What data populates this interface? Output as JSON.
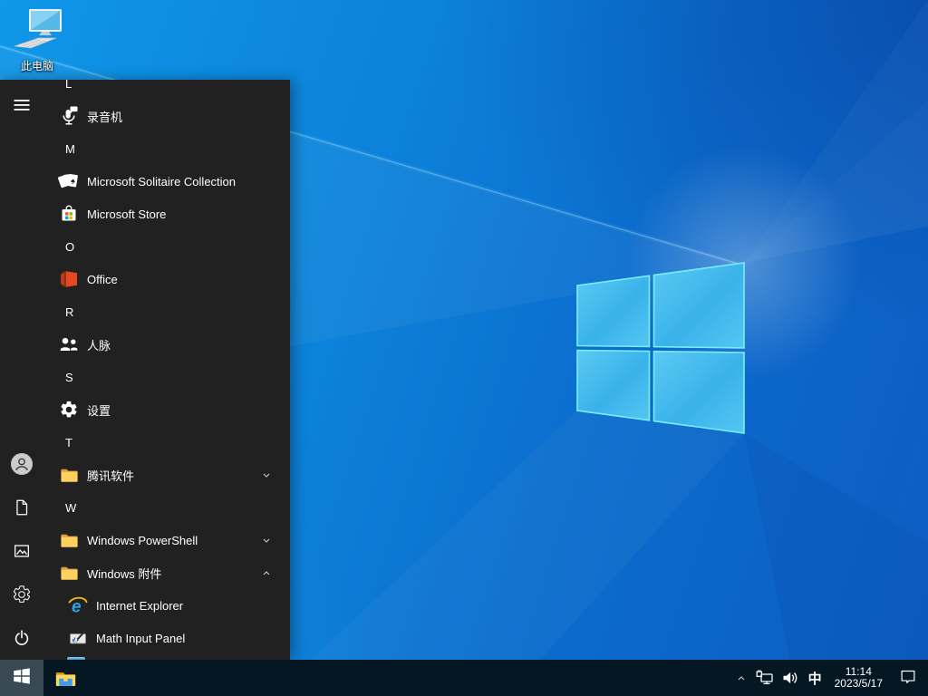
{
  "desktop": {
    "this_pc_label": "此电脑"
  },
  "start_menu": {
    "items": [
      {
        "type": "header",
        "label": "L"
      },
      {
        "type": "app",
        "label": "录音机",
        "icon": "voice-recorder"
      },
      {
        "type": "header",
        "label": "M"
      },
      {
        "type": "app",
        "label": "Microsoft Solitaire Collection",
        "icon": "solitaire"
      },
      {
        "type": "app",
        "label": "Microsoft Store",
        "icon": "store"
      },
      {
        "type": "header",
        "label": "O"
      },
      {
        "type": "app",
        "label": "Office",
        "icon": "office"
      },
      {
        "type": "header",
        "label": "R"
      },
      {
        "type": "app",
        "label": "人脉",
        "icon": "people"
      },
      {
        "type": "header",
        "label": "S"
      },
      {
        "type": "app",
        "label": "设置",
        "icon": "gear"
      },
      {
        "type": "header",
        "label": "T"
      },
      {
        "type": "folder",
        "label": "腾讯软件",
        "icon": "folder",
        "chevron": "down"
      },
      {
        "type": "header",
        "label": "W"
      },
      {
        "type": "folder",
        "label": "Windows PowerShell",
        "icon": "folder",
        "chevron": "down"
      },
      {
        "type": "folder",
        "label": "Windows 附件",
        "icon": "folder",
        "chevron": "up"
      },
      {
        "type": "app",
        "label": "Internet Explorer",
        "icon": "ie",
        "indent": true
      },
      {
        "type": "app",
        "label": "Math Input Panel",
        "icon": "math",
        "indent": true
      }
    ],
    "rail": [
      {
        "name": "menu",
        "icon": "hamburger"
      },
      {
        "name": "user",
        "icon": "user"
      },
      {
        "name": "documents",
        "icon": "document"
      },
      {
        "name": "pictures",
        "icon": "picture"
      },
      {
        "name": "settings",
        "icon": "gear-outline"
      },
      {
        "name": "power",
        "icon": "power"
      }
    ]
  },
  "taskbar": {
    "apps": [
      {
        "name": "file-explorer",
        "icon": "file-explorer"
      }
    ],
    "tray": {
      "icons": [
        {
          "name": "tray-expand",
          "icon": "chevron-up"
        },
        {
          "name": "network",
          "icon": "ethernet"
        },
        {
          "name": "volume",
          "icon": "volume"
        }
      ],
      "ime": "中",
      "clock": {
        "time": "11:14",
        "date": "2023/5/17"
      }
    }
  },
  "colors": {
    "menu_bg": "#212121",
    "taskbar_bg": "#041722",
    "start_button_bg": "#3a4a54",
    "wallpaper_base": "#0c82da",
    "logo_pane_stroke": "#79eefc"
  }
}
